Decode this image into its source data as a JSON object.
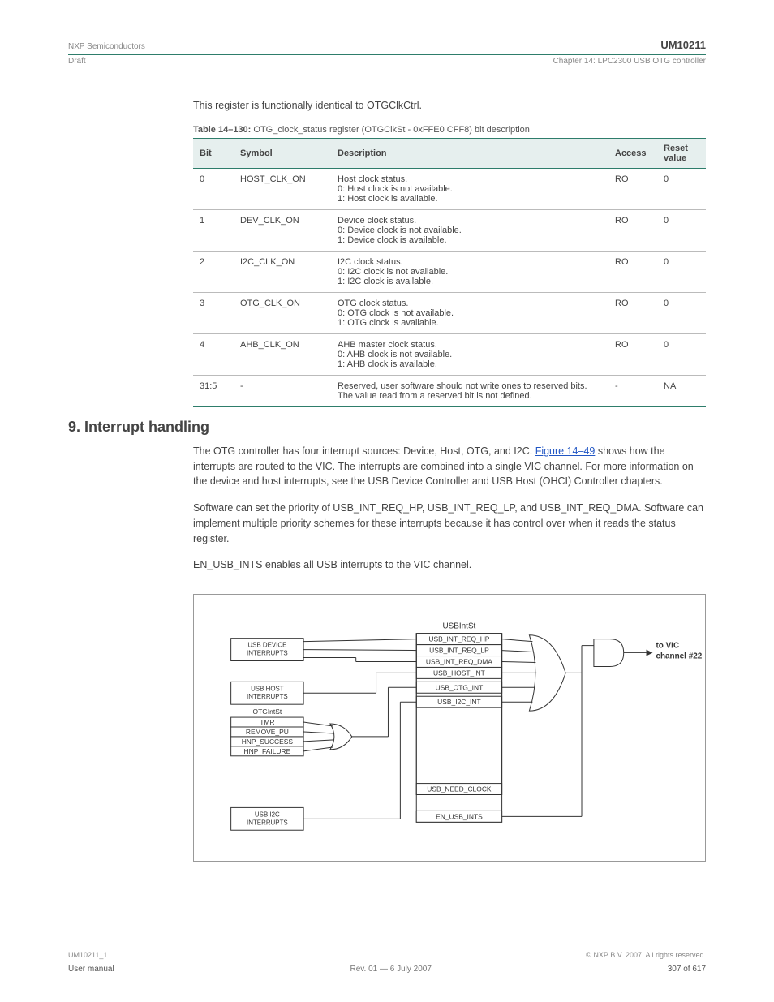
{
  "header": {
    "left": "NXP Semiconductors",
    "right": "UM10211",
    "chapter": "Chapter 14: LPC2300 USB OTG controller",
    "draft": "Draft"
  },
  "para1": "This register is functionally identical to OTGClkCtrl.",
  "table": {
    "caption_label": "Table 14–130:",
    "caption_title": "OTG_clock_status register (OTGClkSt - 0xFFE0 CFF8) bit description",
    "headers": [
      "Bit",
      "Symbol",
      "Description",
      "Access",
      "Reset value"
    ],
    "rows": [
      {
        "bit": "0",
        "symbol": "HOST_CLK_ON",
        "desc": "Host clock status.\n0: Host clock is not available.\n1: Host clock is available.",
        "access": "RO",
        "reset": "0"
      },
      {
        "bit": "1",
        "symbol": "DEV_CLK_ON",
        "desc": "Device clock status.\n0: Device clock is not available.\n1: Device clock is available.",
        "access": "RO",
        "reset": "0"
      },
      {
        "bit": "2",
        "symbol": "I2C_CLK_ON",
        "desc": "I2C clock status.\n0: I2C clock is not available.\n1: I2C clock is available.",
        "access": "RO",
        "reset": "0"
      },
      {
        "bit": "3",
        "symbol": "OTG_CLK_ON",
        "desc": "OTG clock status.\n0: OTG clock is not available.\n1: OTG clock is available.",
        "access": "RO",
        "reset": "0"
      },
      {
        "bit": "4",
        "symbol": "AHB_CLK_ON",
        "desc": "AHB master clock status.\n0: AHB clock is not available.\n1: AHB clock is available.",
        "access": "RO",
        "reset": "0"
      },
      {
        "bit": "31:5",
        "symbol": "-",
        "desc": "Reserved, user software should not write ones to reserved bits. The value read from a reserved bit is not defined.",
        "access": "-",
        "reset": "NA"
      }
    ]
  },
  "section9": {
    "heading": "9. Interrupt handling",
    "p1_a": "The OTG controller has four interrupt sources: Device, Host, OTG, and I2C. ",
    "p1_link": "Figure 14–49",
    "p1_b": " shows how the interrupts are routed to the VIC. The interrupts are combined into a single VIC channel. For more information on the device and host interrupts, see the USB Device Controller and USB Host (OHCI) Controller chapters.",
    "p2": "Software can set the priority of USB_INT_REQ_HP, USB_INT_REQ_LP, and USB_INT_REQ_DMA. Software can implement multiple priority schemes for these interrupts because it has control over when it reads the status register.",
    "p3": "EN_USB_INTS enables all USB interrupts to the VIC channel."
  },
  "figure": {
    "usbintst_title": "USBIntSt",
    "regs": [
      "USB_INT_REQ_HP",
      "USB_INT_REQ_LP",
      "USB_INT_REQ_DMA",
      "USB_HOST_INT",
      "USB_OTG_INT",
      "USB_I2C_INT"
    ],
    "need_clock": "USB_NEED_CLOCK",
    "en_usb_ints": "EN_USB_INTS",
    "usb_device": "USB DEVICE\nINTERRUPTS",
    "usb_host": "USB HOST\nINTERRUPTS",
    "usb_i2c": "USB I2C\nINTERRUPTS",
    "otgintst": "OTGIntSt",
    "otg_rows": [
      "TMR",
      "REMOVE_PU",
      "HNP_SUCCESS",
      "HNP_FAILURE"
    ],
    "to_vic_1": "to VIC",
    "to_vic_2": "channel #22"
  },
  "footer": {
    "doc": "UM10211_1",
    "copy": "© NXP B.V. 2007. All rights reserved.",
    "um": "User manual",
    "rev": "Rev. 01 — 6 July 2007",
    "page": "307 of 617"
  }
}
